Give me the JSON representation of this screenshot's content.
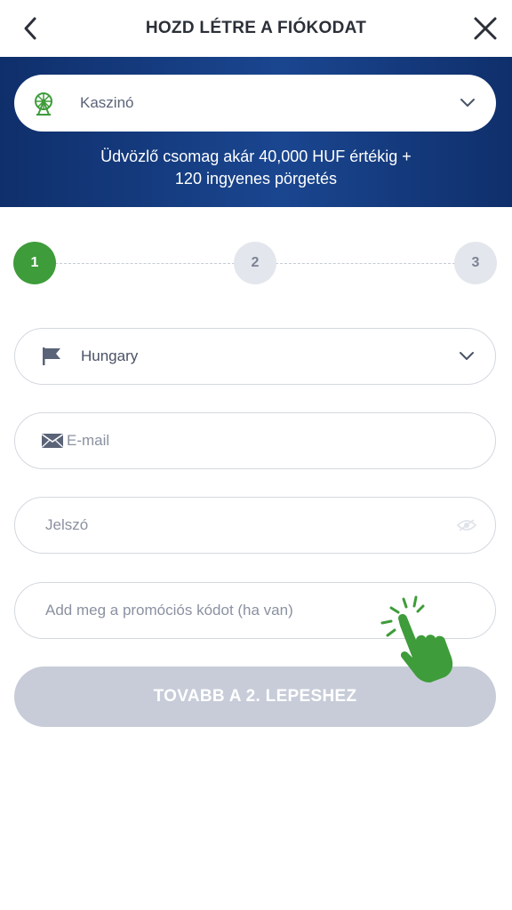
{
  "header": {
    "title": "HOZD LÉTRE A FIÓKODAT",
    "back_icon": "chevron-left-icon",
    "close_icon": "close-icon"
  },
  "banner": {
    "product_select": {
      "icon": "ferris-wheel-icon",
      "value": "Kaszinó"
    },
    "promo_line1": "Üdvözlő csomag akár 40,000 HUF értékig +",
    "promo_line2": "120 ingyenes pörgetés",
    "colors": {
      "background": "#1a4690",
      "icon_green": "#3e9c3a"
    }
  },
  "stepper": {
    "steps": [
      "1",
      "2",
      "3"
    ],
    "active_step": "1",
    "colors": {
      "active": "#3e9c3a",
      "inactive": "#e3e6ec"
    }
  },
  "form": {
    "country": {
      "icon": "flag-icon",
      "value": "Hungary"
    },
    "email": {
      "icon": "envelope-icon",
      "placeholder": "E-mail"
    },
    "password": {
      "placeholder": "Jelszó",
      "toggle_icon": "eye-icon"
    },
    "promo_code": {
      "placeholder": "Add meg a promóciós kódot (ha van)"
    }
  },
  "submit": {
    "label": "TOVABB A 2. LEPESHEZ",
    "color": "#c7ccd8"
  },
  "overlay": {
    "icon": "tap-hand-icon",
    "color": "#3e9c3a"
  }
}
